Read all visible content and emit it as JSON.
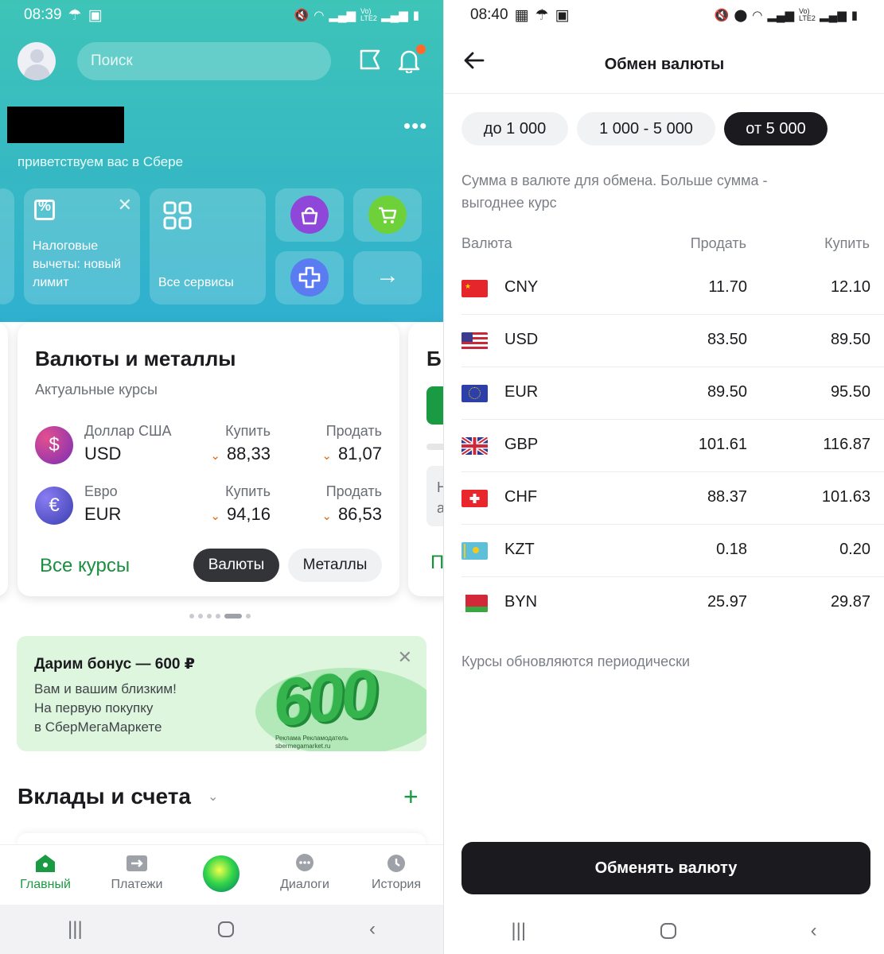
{
  "left": {
    "status": {
      "time": "08:39",
      "lte": "Vo) LTE2"
    },
    "search": {
      "placeholder": "Поиск"
    },
    "greeting": "приветствуем вас в Сбере",
    "tiles": {
      "tax": "Налоговые вычеты: новый лимит",
      "services": "Все сервисы"
    },
    "currency_card": {
      "title": "Валюты и металлы",
      "subtitle": "Актуальные курсы",
      "rows": [
        {
          "name": "Доллар США",
          "code": "USD",
          "symbol": "$",
          "buy_label": "Купить",
          "buy": "88,33",
          "sell_label": "Продать",
          "sell": "81,07"
        },
        {
          "name": "Евро",
          "code": "EUR",
          "symbol": "€",
          "buy_label": "Купить",
          "buy": "94,16",
          "sell_label": "Продать",
          "sell": "86,53"
        }
      ],
      "all_rates": "Все курсы",
      "toggle_currencies": "Валюты",
      "toggle_metals": "Металлы"
    },
    "side_card_letters": {
      "title": "Б",
      "line1": "Н",
      "line2": "а",
      "link": "П"
    },
    "banner": {
      "title": "Дарим бонус — 600 ₽",
      "text": "Вам и вашим близким!\nНа первую покупку\nв СберМегаМаркете",
      "big": "600",
      "ad_note": "Реклама Рекламодатель\nsbermegamarket.ru"
    },
    "deposits": {
      "title": "Вклады и счета"
    },
    "tabs": [
      {
        "label": "Главный"
      },
      {
        "label": "Платежи"
      },
      {
        "label": ""
      },
      {
        "label": "Диалоги"
      },
      {
        "label": "История"
      }
    ]
  },
  "right": {
    "status": {
      "time": "08:40",
      "lte": "Vo) LTE2"
    },
    "title": "Обмен валюты",
    "chips": [
      {
        "label": "до 1 000",
        "active": false
      },
      {
        "label": "1 000 - 5 000",
        "active": false
      },
      {
        "label": "от 5 000",
        "active": true
      }
    ],
    "hint": "Сумма в валюте для обмена. Больше сумма - выгоднее курс",
    "table": {
      "headers": {
        "currency": "Валюта",
        "sell": "Продать",
        "buy": "Купить"
      },
      "rows": [
        {
          "code": "CNY",
          "sell": "11.70",
          "buy": "12.10"
        },
        {
          "code": "USD",
          "sell": "83.50",
          "buy": "89.50"
        },
        {
          "code": "EUR",
          "sell": "89.50",
          "buy": "95.50"
        },
        {
          "code": "GBP",
          "sell": "101.61",
          "buy": "116.87"
        },
        {
          "code": "CHF",
          "sell": "88.37",
          "buy": "101.63"
        },
        {
          "code": "KZT",
          "sell": "0.18",
          "buy": "0.20"
        },
        {
          "code": "BYN",
          "sell": "25.97",
          "buy": "29.87"
        }
      ]
    },
    "note": "Курсы обновляются периодически",
    "button": "Обменять валюту"
  },
  "colors": {
    "brand_green": "#1a9b43",
    "hero_teal": "#36b8c4",
    "dark": "#1b1b1f"
  }
}
